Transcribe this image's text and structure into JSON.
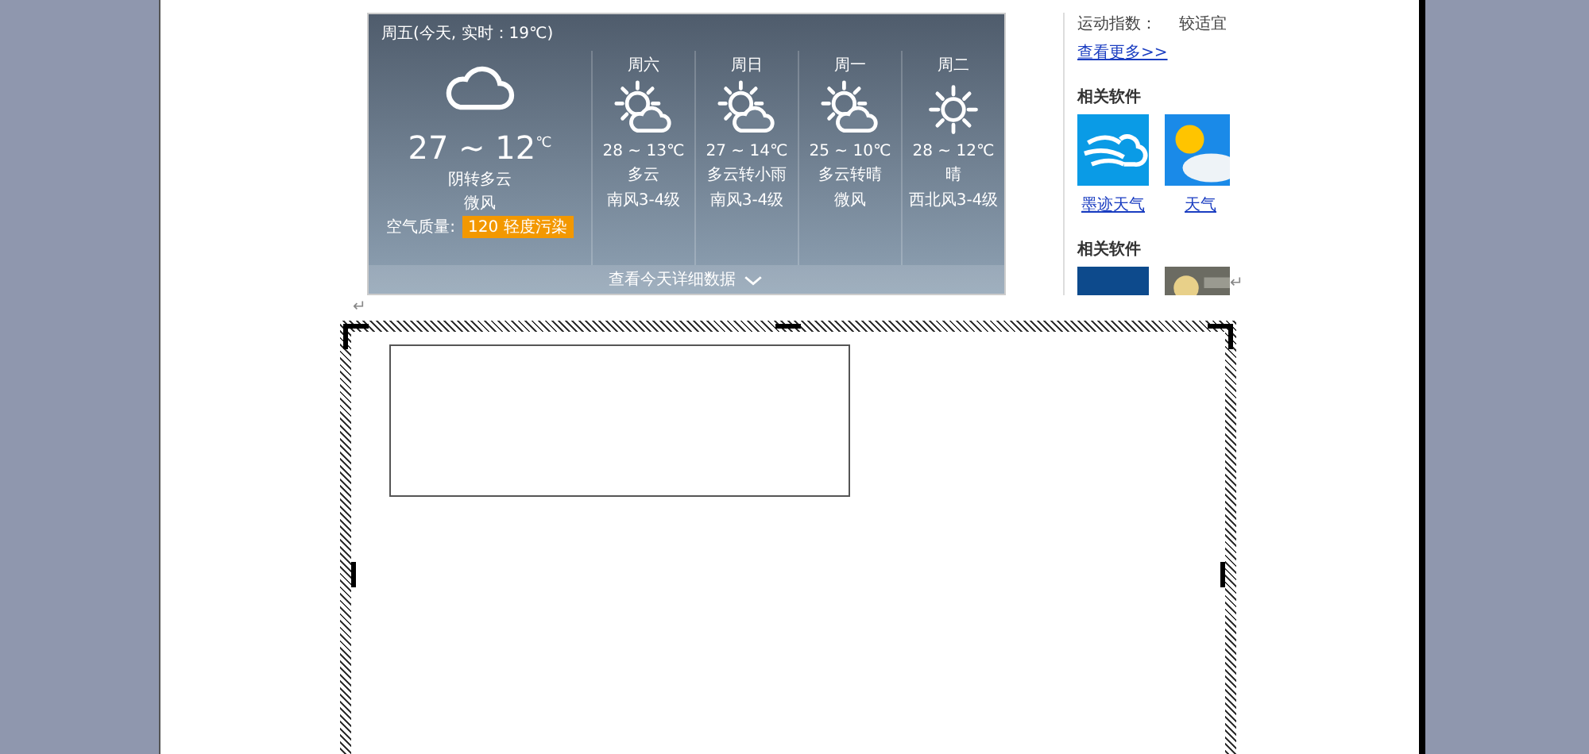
{
  "weather": {
    "header": "周五(今天, 实时：19℃)",
    "today_temp": "27 ~ 12$^{℃}$",
    "today_condition": "阴转多云",
    "today_wind": "微风",
    "aqi_label": "空气质量:",
    "aqi_badge": "120 轻度污染",
    "forecast": [
      {
        "day": "周六",
        "kind": "sun-cloud",
        "temp": "28 ~ 13℃",
        "condition": "多云",
        "wind": "南风3-4级"
      },
      {
        "day": "周日",
        "kind": "sun-cloud",
        "temp": "27 ~ 14℃",
        "condition": "多云转小雨",
        "wind": "南风3-4级"
      },
      {
        "day": "周一",
        "kind": "sun-cloud",
        "temp": "25 ~ 10℃",
        "condition": "多云转晴",
        "wind": "微风"
      },
      {
        "day": "周二",
        "kind": "sun",
        "temp": "28 ~ 12℃",
        "condition": "晴",
        "wind": "西北风3-4级"
      }
    ],
    "details_link": "查看今天详细数据"
  },
  "sidebar": {
    "index_rows": [
      {
        "label": "运动指数：",
        "value": "较适宜"
      }
    ],
    "more_link": "查看更多>>",
    "sections": [
      {
        "title": "相关软件",
        "apps": [
          {
            "kind": "wind-cloud",
            "name": "墨迹天气"
          },
          {
            "kind": "sun-cloud",
            "name": "天气"
          }
        ]
      },
      {
        "title": "相关软件",
        "apps": [
          {
            "kind": "dark-tile"
          },
          {
            "kind": "picture"
          }
        ],
        "mark": "↵"
      }
    ]
  },
  "document": {
    "paragraph_mark": "↵"
  }
}
